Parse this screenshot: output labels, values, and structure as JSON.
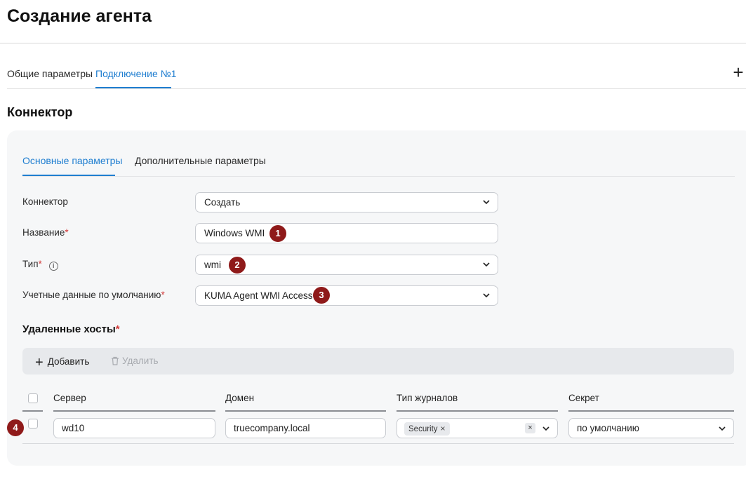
{
  "page": {
    "title": "Создание агента"
  },
  "top_tabs": [
    {
      "label": "Общие параметры"
    },
    {
      "label": "Подключение №1"
    }
  ],
  "add_tab_symbol": "+",
  "section_title": "Коннектор",
  "inner_tabs": [
    {
      "label": "Основные параметры"
    },
    {
      "label": "Дополнительные параметры"
    }
  ],
  "form": {
    "connector": {
      "label": "Коннектор",
      "value": "Создать"
    },
    "name": {
      "label": "Название",
      "required_mark": "*",
      "value": "Windows WMI"
    },
    "type": {
      "label": "Тип",
      "required_mark": "*",
      "value": "wmi",
      "info_icon": "i"
    },
    "credentials": {
      "label": "Учетные данные по умолчанию",
      "required_mark": "*",
      "value": "KUMA Agent WMI Access"
    }
  },
  "remote_hosts": {
    "title": "Удаленные хосты",
    "required_mark": "*",
    "toolbar": {
      "add_label": "Добавить",
      "delete_label": "Удалить"
    },
    "columns": [
      "Сервер",
      "Домен",
      "Тип журналов",
      "Секрет"
    ],
    "rows": [
      {
        "server": "wd10",
        "domain": "truecompany.local",
        "log_tags": [
          "Security"
        ],
        "secret": "по умолчанию"
      }
    ]
  },
  "markers": [
    "1",
    "2",
    "3",
    "4"
  ],
  "colors": {
    "accent": "#1f7ed0",
    "marker": "#8f1a1a",
    "required": "#d23a3a"
  }
}
